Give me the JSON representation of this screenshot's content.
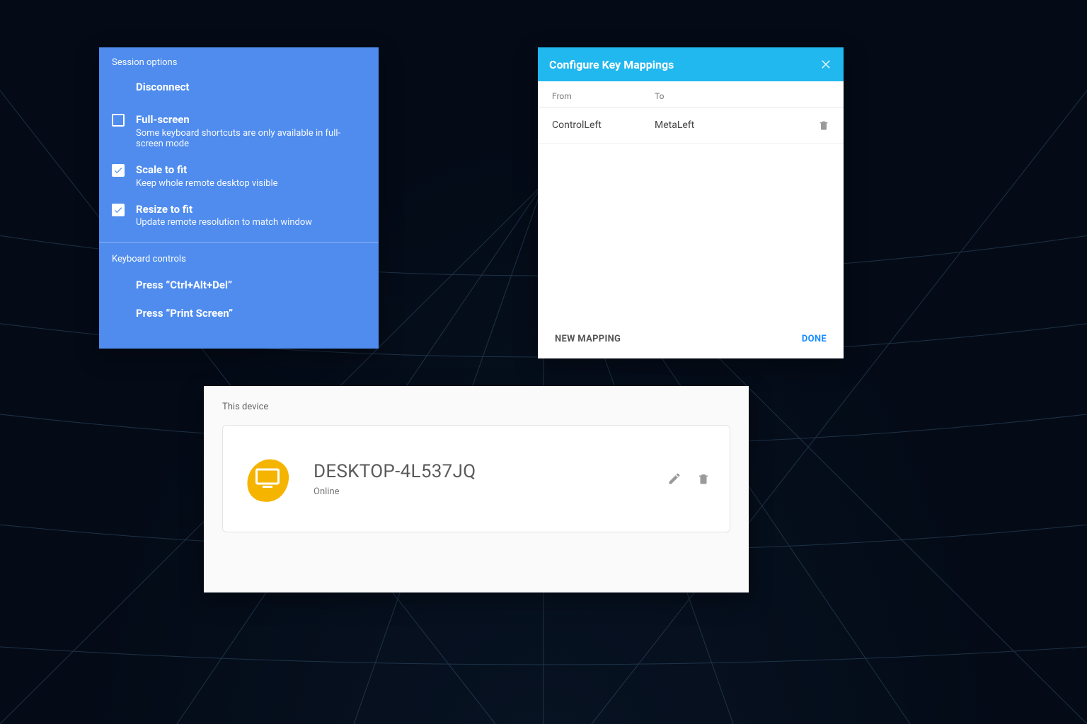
{
  "session": {
    "section_title": "Session options",
    "disconnect_label": "Disconnect",
    "fullscreen": {
      "label": "Full-screen",
      "desc": "Some keyboard shortcuts are only available in full-screen mode",
      "checked": false
    },
    "scale": {
      "label": "Scale to fit",
      "desc": "Keep whole remote desktop visible",
      "checked": true
    },
    "resize": {
      "label": "Resize to fit",
      "desc": "Update remote resolution to match window",
      "checked": true
    },
    "keyboard_section_title": "Keyboard controls",
    "press_ctrl_alt_del": "Press “Ctrl+Alt+Del”",
    "press_print_screen": "Press “Print Screen”"
  },
  "keymap": {
    "title": "Configure Key Mappings",
    "header_from": "From",
    "header_to": "To",
    "rows": [
      {
        "from": "ControlLeft",
        "to": "MetaLeft"
      }
    ],
    "new_mapping": "NEW MAPPING",
    "done": "DONE"
  },
  "device": {
    "section_title": "This device",
    "name": "DESKTOP-4L537JQ",
    "status": "Online"
  }
}
